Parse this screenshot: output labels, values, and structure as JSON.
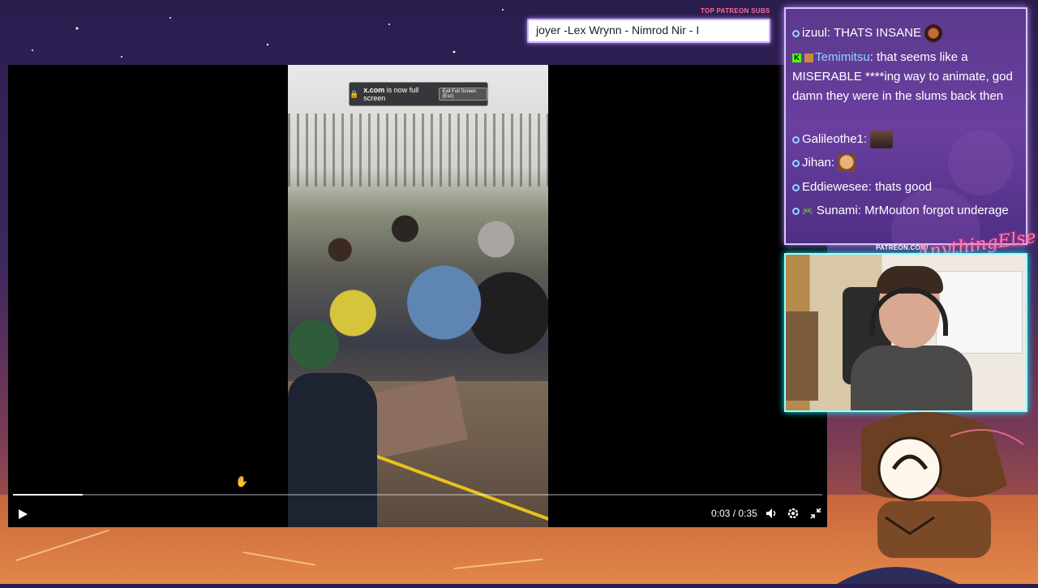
{
  "player": {
    "fullscreen_notice": {
      "domain": "x.com",
      "message": "is now full screen",
      "exit_label": "Exit Full Screen (Esc)"
    },
    "time_current": "0:03",
    "time_total": "0:35",
    "time_separator": "/",
    "progress_fraction": 0.086
  },
  "subs": {
    "label": "TOP PATREON SUBS",
    "names": "joyer -Lex Wrynn - Nimrod Nir - I"
  },
  "chat": {
    "messages": [
      {
        "user": "izuul",
        "text": "THATS INSANE"
      },
      {
        "user": "Temimitsu",
        "text": "that seems like a MISERABLE ****ing way to animate, god damn they were in the slums back then"
      },
      {
        "user": "Galileothe1",
        "text": ""
      },
      {
        "user": "Jihan",
        "text": ""
      },
      {
        "user": "Eddiewesee",
        "text": "thats good"
      },
      {
        "user": "Sunami",
        "text": "MrMouton forgot underage"
      }
    ],
    "separator": ":"
  },
  "cam": {
    "patreon_label": "PATREON.COM/",
    "brand": "AnythingElse"
  },
  "colors": {
    "accent_pink": "#ff6b9d",
    "chat_border": "#d9c6ff",
    "cam_border": "#9ffcff",
    "kick_green": "#53fc18"
  }
}
